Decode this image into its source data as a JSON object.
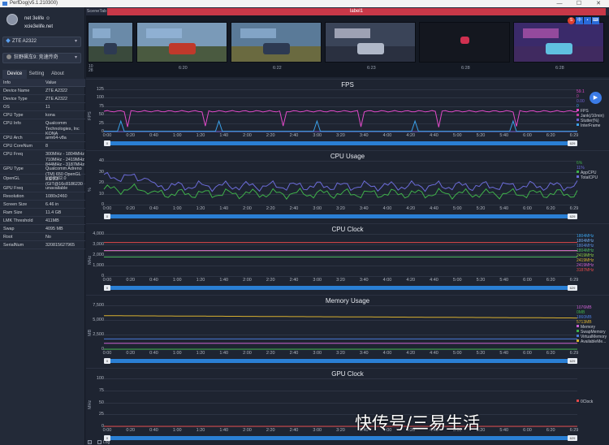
{
  "window": {
    "title": "PerfDog(v5.1.210300)",
    "controls": [
      "—",
      "☐",
      "✕"
    ]
  },
  "user": {
    "name": "net 3elife ☺",
    "email": "xcie3elife.net"
  },
  "device_select": {
    "value": "ZTE A2322"
  },
  "app_select": {
    "value": "狂野飙车9: 竞速传奇"
  },
  "tabs": [
    "Device",
    "Setting",
    "About"
  ],
  "info_table": {
    "headers": [
      "Info",
      "Value"
    ],
    "rows": [
      {
        "k": "Device Name",
        "v": "ZTE A2322"
      },
      {
        "k": "Device Type",
        "v": "ZTE A2322"
      },
      {
        "k": "OS",
        "v": "11"
      },
      {
        "k": "CPU Type",
        "v": "kona"
      },
      {
        "k": "CPU Info",
        "v": "Qualcomm Technologies, Inc KONA"
      },
      {
        "k": "CPU Arch",
        "v": "arm64-v8a"
      },
      {
        "k": "CPU CoreNum",
        "v": "8"
      },
      {
        "k": "CPU Freq",
        "v": "300MHz - 1804MHz 710MHz - 2419MHz 844MHz - 3187MHz"
      },
      {
        "k": "GPU Type",
        "v": "Qualcomm Adreno (TM) 650 OpenGL ES 3.2"
      },
      {
        "k": "OpenGL",
        "v": "V@0502.0 (GIT@16c8186230"
      },
      {
        "k": "GPU Freq",
        "v": "unavailable"
      },
      {
        "k": "Resolution",
        "v": "1080x2460"
      },
      {
        "k": "Screen Size",
        "v": "6.46 in"
      },
      {
        "k": "Ram Size",
        "v": "11.4 GB"
      },
      {
        "k": "LMK Threshold",
        "v": "411MB"
      },
      {
        "k": "Swap",
        "v": "4095 MB"
      },
      {
        "k": "Root",
        "v": "No"
      },
      {
        "k": "SerialNum",
        "v": "320815627965"
      }
    ]
  },
  "scene": {
    "tab_label": "SceneTab",
    "label": "label1",
    "left_marks": [
      "10",
      "28"
    ]
  },
  "thumb_times": [
    "6:20",
    "6:22",
    "6:23",
    "6:28",
    "6:28"
  ],
  "header_ctrls": [
    "S",
    "中",
    "•",
    "⌨"
  ],
  "x_ticks": [
    "0:00",
    "0:20",
    "0:40",
    "1:00",
    "1:20",
    "1:40",
    "2:00",
    "2:20",
    "2:40",
    "3:00",
    "3:20",
    "3:40",
    "4:00",
    "4:20",
    "4:40",
    "5:00",
    "5:20",
    "5:40",
    "6:00",
    "6:20",
    "6:29"
  ],
  "scroll_start": "0",
  "scroll_end": "629",
  "chart_data": [
    {
      "type": "line",
      "title": "FPS",
      "ylabel": "FPS",
      "yticks": [
        "125",
        "100",
        "75",
        "50",
        "25",
        "0"
      ],
      "ylim": [
        0,
        125
      ],
      "legend_values": [
        "59.1",
        "0",
        "0.00",
        "0"
      ],
      "series": [
        {
          "name": "FPS",
          "color": "#e04ac8",
          "level": 60
        },
        {
          "name": "Jank(/10min)",
          "color": "#c040a0",
          "level": 0
        },
        {
          "name": "Stutter(%)",
          "color": "#7060d0",
          "level": 0
        },
        {
          "name": "InterFrame",
          "color": "#3aa0e8",
          "level": 1
        }
      ]
    },
    {
      "type": "line",
      "title": "CPU Usage",
      "ylabel": "%",
      "yticks": [
        "40",
        "30",
        "20",
        "10",
        "0"
      ],
      "ylim": [
        0,
        40
      ],
      "legend_values": [
        "6%",
        "11%"
      ],
      "series": [
        {
          "name": "AppCPU",
          "color": "#3fb04a",
          "level": 10
        },
        {
          "name": "TotalCPU",
          "color": "#6b6bd8",
          "level": 17
        }
      ]
    },
    {
      "type": "line",
      "title": "CPU Clock",
      "ylabel": "MHz",
      "yticks": [
        "4,000",
        "3,000",
        "2,000",
        "1,000",
        "0"
      ],
      "ylim": [
        0,
        4000
      ],
      "legend_values": [
        "1804MHz",
        "1804MHz",
        "1804MHz",
        "1804MHz",
        "2419MHz",
        "2419MHz",
        "2419MHz",
        "3187MHz"
      ],
      "series": [
        {
          "name": "CPU0",
          "color": "#3aa0e8",
          "level": 1804
        },
        {
          "name": "CPU1",
          "color": "#6fa6e8",
          "level": 1804
        },
        {
          "name": "CPU2",
          "color": "#5a8ad8",
          "level": 1804
        },
        {
          "name": "CPU3",
          "color": "#4ab860",
          "level": 1804
        },
        {
          "name": "CPU4",
          "color": "#8cc840",
          "level": 2419
        },
        {
          "name": "CPU5",
          "color": "#d8b030",
          "level": 2419
        },
        {
          "name": "CPU6",
          "color": "#c860d0",
          "level": 2419
        },
        {
          "name": "CPU7",
          "color": "#e04848",
          "level": 3187
        }
      ]
    },
    {
      "type": "line",
      "title": "Memory Usage",
      "ylabel": "MB",
      "yticks": [
        "7,500",
        "5,000",
        "2,500",
        "0"
      ],
      "ylim": [
        0,
        8000
      ],
      "legend_values": [
        "1076MB",
        "0MB",
        "1860MB",
        "5713MB"
      ],
      "series": [
        {
          "name": "Memory",
          "color": "#c860d0",
          "level": 1076
        },
        {
          "name": "SwapMemory",
          "color": "#3fb04a",
          "level": 0
        },
        {
          "name": "VirtualMemory",
          "color": "#4a7ad8",
          "level": 1860
        },
        {
          "name": "AvailableMe...",
          "color": "#d8b030",
          "level": 5713
        }
      ]
    },
    {
      "type": "line",
      "title": "GPU Clock",
      "ylabel": "MHz",
      "yticks": [
        "100",
        "75",
        "50",
        "25",
        "0"
      ],
      "ylim": [
        0,
        100
      ],
      "legend_values": [],
      "series": [
        {
          "name": "0Clock",
          "color": "#e04848",
          "level": 0
        }
      ]
    }
  ],
  "bottom": {
    "log_label": "Log"
  },
  "watermark": "快传号/三易生活"
}
